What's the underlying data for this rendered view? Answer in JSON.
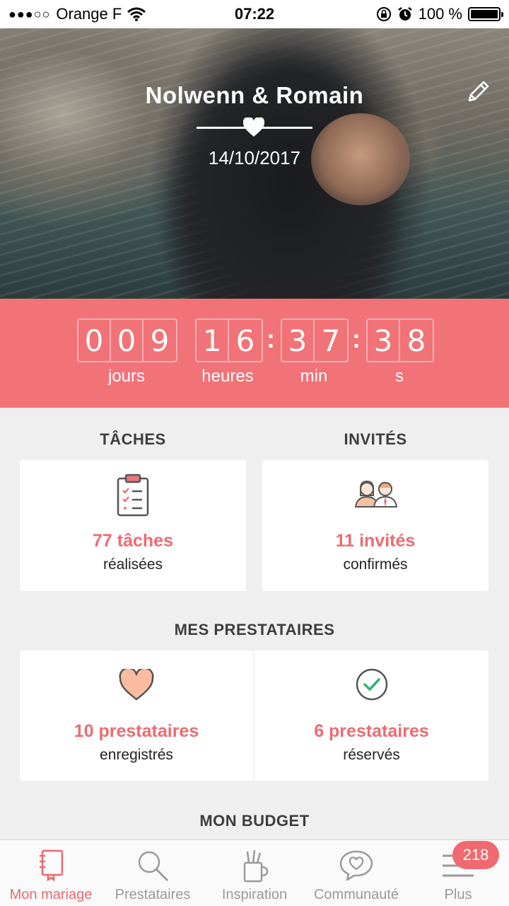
{
  "status_bar": {
    "signal": "●●●○○",
    "carrier": "Orange F",
    "time": "07:22",
    "battery_text": "100 %",
    "icons": [
      "wifi-icon",
      "rotation-lock-icon",
      "alarm-icon",
      "battery-icon"
    ]
  },
  "hero": {
    "title": "Nolwenn & Romain",
    "date": "14/10/2017",
    "edit_icon": "pencil-icon"
  },
  "countdown": {
    "days": [
      "0",
      "0",
      "9"
    ],
    "hours": [
      "1",
      "6"
    ],
    "minutes": [
      "3",
      "7"
    ],
    "seconds": [
      "3",
      "8"
    ],
    "separator": ":",
    "labels": {
      "days": "jours",
      "hours": "heures",
      "minutes": "min",
      "seconds": "s"
    },
    "background": "#f17277"
  },
  "tasks": {
    "heading": "TÂCHES",
    "value": "77 tâches",
    "sub": "réalisées",
    "icon": "clipboard-checklist-icon"
  },
  "guests": {
    "heading": "INVITÉS",
    "value": "11 invités",
    "sub": "confirmés",
    "icon": "couple-guests-icon"
  },
  "vendors": {
    "heading": "MES PRESTATAIRES",
    "saved": {
      "value": "10 prestataires",
      "sub": "enregistrés",
      "icon": "heart-icon"
    },
    "booked": {
      "value": "6 prestataires",
      "sub": "réservés",
      "icon": "check-circle-icon"
    }
  },
  "budget": {
    "heading": "MON BUDGET"
  },
  "tab_bar": {
    "tabs": [
      {
        "label": "Mon mariage",
        "icon": "notebook-icon",
        "active": true
      },
      {
        "label": "Prestataires",
        "icon": "search-icon",
        "active": false
      },
      {
        "label": "Inspiration",
        "icon": "pencil-cup-icon",
        "active": false
      },
      {
        "label": "Communauté",
        "icon": "chat-heart-icon",
        "active": false
      },
      {
        "label": "Plus",
        "icon": "menu-icon",
        "active": false
      }
    ],
    "badge": "218"
  },
  "colors": {
    "accent": "#f17277",
    "text_accent": "#ec6c71",
    "background": "#efefef"
  }
}
